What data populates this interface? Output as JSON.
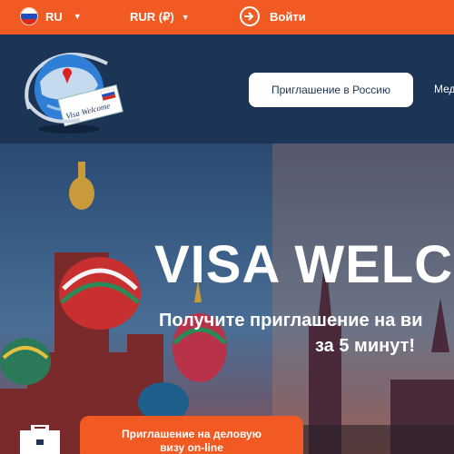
{
  "topbar": {
    "language": "RU",
    "currency": "RUR (₽)",
    "login_label": "Войти",
    "bg_color": "#f15a22"
  },
  "header": {
    "logo_text": "Visa Welcome",
    "nav_button": "Приглашение в Россию",
    "nav_next": "Мед",
    "bg_color": "#1c3556"
  },
  "hero": {
    "title": "VISA WELC",
    "subtitle_line1": "Получите приглашение на ви",
    "subtitle_line2": "за 5 минут!",
    "cta_line1": "Приглашение на деловую",
    "cta_line2": "визу on-line"
  },
  "icons": [
    "russia-flag-icon",
    "chevron-down-icon",
    "login-icon",
    "globe-logo-icon",
    "briefcase-icon"
  ]
}
